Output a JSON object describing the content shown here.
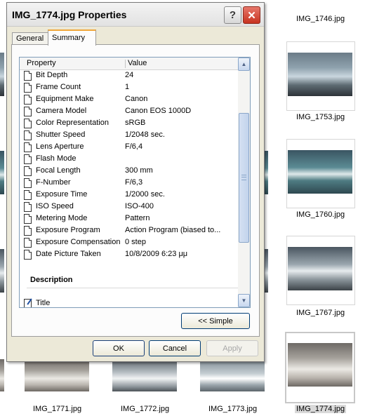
{
  "dialog": {
    "title": "IMG_1774.jpg Properties",
    "help_glyph": "?",
    "close_glyph": "✕",
    "tabs": [
      "General",
      "Summary"
    ],
    "active_tab": "Summary",
    "grid": {
      "col_property": "Property",
      "col_value": "Value",
      "rows": [
        {
          "name": "Bit Depth",
          "value": "24"
        },
        {
          "name": "Frame Count",
          "value": "1"
        },
        {
          "name": "Equipment Make",
          "value": "Canon"
        },
        {
          "name": "Camera Model",
          "value": "Canon EOS 1000D"
        },
        {
          "name": "Color Representation",
          "value": "sRGB"
        },
        {
          "name": "Shutter Speed",
          "value": "1/2048 sec."
        },
        {
          "name": "Lens Aperture",
          "value": "F/6,4"
        },
        {
          "name": "Flash Mode",
          "value": ""
        },
        {
          "name": "Focal Length",
          "value": "300 mm"
        },
        {
          "name": "F-Number",
          "value": "F/6,3"
        },
        {
          "name": "Exposure Time",
          "value": "1/2000 sec."
        },
        {
          "name": "ISO Speed",
          "value": "ISO-400"
        },
        {
          "name": "Metering Mode",
          "value": "Pattern"
        },
        {
          "name": "Exposure Program",
          "value": "Action Program (biased to..."
        },
        {
          "name": "Exposure Compensation",
          "value": "0 step"
        },
        {
          "name": "Date Picture Taken",
          "value": "10/8/2009 6:23 μμ"
        }
      ],
      "section_description": "Description",
      "title_row": "Title"
    },
    "simple_button": "<< Simple",
    "ok_button": "OK",
    "cancel_button": "Cancel",
    "apply_button": "Apply"
  },
  "explorer": {
    "thumbnails": [
      {
        "label": "IMG_1746.jpg"
      },
      {
        "label": "IMG_1753.jpg"
      },
      {
        "label": "IMG_1760.jpg"
      },
      {
        "label": "IMG_1767.jpg"
      },
      {
        "label": "IMG_1771.jpg"
      },
      {
        "label": "IMG_1772.jpg"
      },
      {
        "label": "IMG_1773.jpg"
      },
      {
        "label": "IMG_1774.jpg"
      }
    ]
  },
  "colors": {
    "accent_tab": "#f0a73a",
    "close_button": "#c7321f",
    "dialog_bg": "#ece9d8"
  }
}
